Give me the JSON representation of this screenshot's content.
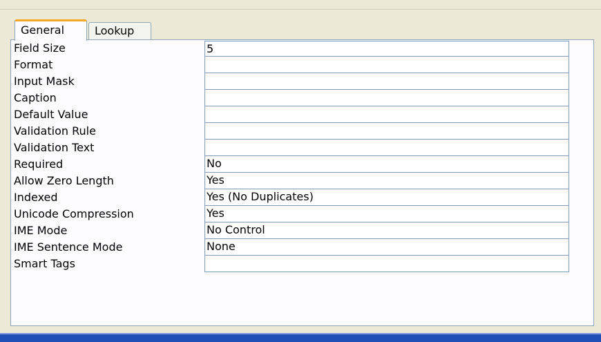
{
  "tabs": [
    {
      "label": "General",
      "active": true
    },
    {
      "label": "Lookup",
      "active": false
    }
  ],
  "properties": [
    {
      "label": "Field Size",
      "value": "5"
    },
    {
      "label": "Format",
      "value": ""
    },
    {
      "label": "Input Mask",
      "value": ""
    },
    {
      "label": "Caption",
      "value": ""
    },
    {
      "label": "Default Value",
      "value": ""
    },
    {
      "label": "Validation Rule",
      "value": ""
    },
    {
      "label": "Validation Text",
      "value": ""
    },
    {
      "label": "Required",
      "value": "No"
    },
    {
      "label": "Allow Zero Length",
      "value": "Yes"
    },
    {
      "label": "Indexed",
      "value": "Yes (No Duplicates)"
    },
    {
      "label": "Unicode Compression",
      "value": "Yes"
    },
    {
      "label": "IME Mode",
      "value": "No Control"
    },
    {
      "label": "IME Sentence Mode",
      "value": "None"
    },
    {
      "label": "Smart Tags",
      "value": ""
    }
  ],
  "colors": {
    "window_bg": "#ece9d8",
    "active_tab_accent": "#f5a623",
    "field_border": "#7f9db9",
    "taskbar": "#1f4fb7"
  }
}
